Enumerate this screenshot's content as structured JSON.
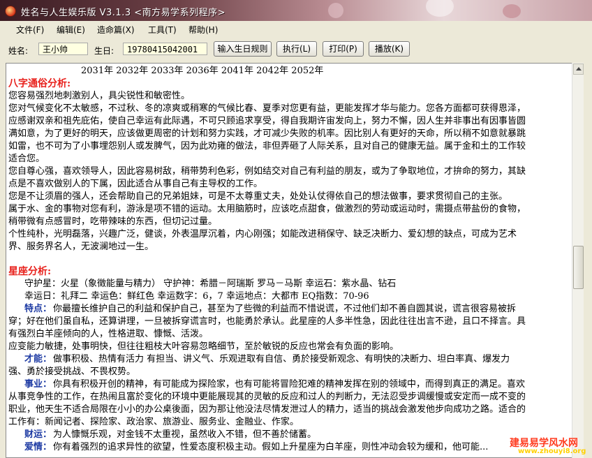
{
  "window": {
    "title": "姓名与人生娱乐版 V3.1.3   <南方易学系列程序>"
  },
  "menu": [
    "文件(F)",
    "编辑(E)",
    "造命篇(X)",
    "工具(T)",
    "帮助(H)"
  ],
  "form": {
    "name_label": "姓名:",
    "name_value": "王小帅",
    "birthday_label": "生日:",
    "birthday_value": "19780415042001"
  },
  "buttons": {
    "rule": "输入生日规则",
    "run": "执行(L)",
    "print": "打印(P)",
    "play": "播放(K)"
  },
  "content": {
    "years_line": "2031年 2032年 2033年 2036年 2041年 2042年 2052年",
    "folk_title": "八字通俗分析:",
    "folk_lines": [
      "您容易强烈地刺激别人，具尖锐性和敏密性。",
      "您对气候变化不太敏感，不过秋、冬的凉爽或稍寒的气候比春、夏季对您更有益，更能发挥才华与能力。您各方面都可获得恩泽，",
      "应感谢双亲和祖先庇佑，使自己幸运有此际遇，不可只顾追求享受，得自我期许宙发向上，努力不懈，因人生并非事出有因事皆圆",
      "满如意，为了更好的明天，应该做更周密的计划和努力实践，才可减少失败的机率。因比别人有更好的天命，所以稍不如意就暴跳",
      "如雷，也不可为了小事埋怨别人或发脾气，因为此劝雍的做法，非但弄砸了人际关系，且对自己的健康无益。属于金和土的工作较",
      "适合您。",
      "您自尊心强，喜欢领导人，因此容易树敌，稍带势利色彩，例如结交对自己有利益的朋友，或为了争取地位，才拚命的努力，其缺",
      "点是不喜欢做别人的下属，因此适合从事自己有主导权的工作。",
      "您是不让须眉的强人，还会帮助自己的兄弟姐妹，可是不太尊重丈夫，处处认仗得依自己的想法做事，要求贯彻自己的主张。",
      "属于水、金的事物对您有利，游泳是项不错的运动。太用脑筋时，应该吃点甜食，做激烈的劳动或运动时，需摄点带盐份的食物，",
      "稍带微有点感冒时，吃带辣味的东西，但切记过量。",
      "个性纯朴，光明磊落，兴趣广泛，健谈，外表温厚沉着，内心刚强；如能改进稍保守、缺乏决断力、爱幻想的缺点，可成为艺术",
      "界、服务界名人，无波澜地过一生。"
    ],
    "star_title": "星座分析:",
    "star_lines": [
      "守护星：火星（象徵能量与精力） 守护神：希腊－阿瑞斯 罗马－马斯 幸运石：紫水晶、钻石",
      "幸运日：礼拜二   幸运色：鲜红色  幸运数字：6，7   幸运地点：大都市  EQ指数：70-96"
    ],
    "trait_label": "特点：",
    "trait_lines": [
      "你最擅长维护自己的利益和保护自己，甚至为了些微的利益而不惜说谎，不过他们却不善自圆其说，谎言很容易被拆",
      "穿；好在他们虽自私，还算讲理，一旦被拆穿谎言时，也能勇於承认。此星座的人多半性急，因此往往出言不逊，且口不择言。具",
      "有强烈白羊座倾向的人，性格进取、慷慨、活泼。",
      "应变能力敏捷，处事明快，但往往粗枝大叶容易忽略细节，至於敏锐的反应也常会有负面的影响。"
    ],
    "talent_label": "才能：",
    "talent_lines": [
      "做事积极、热情有活力 有担当、讲义气、乐观进取有自信、勇於接受新观念、有明快的决断力、坦白率真、爆发力",
      "强、勇於接受挑战、不畏权势。"
    ],
    "career_label": "事业：",
    "career_lines": [
      "你具有积极开创的精神，有可能成为探险家，也有可能将冒险犯难的精神发挥在别的领域中，而得到真正的满足。喜欢",
      "从事竞争性的工作，在热闹且富於变化的环境中更能展现其的灵敏的反应和过人的判断力，无法忍受步调缓慢或安定而一成不变的",
      "职业，他天生不适合局限在小小的办公桌後面，因为那让他没法尽情发泄过人的精力，适当的挑战会激发他步向成功之路。适合的",
      "工作有：新闻记者、探险家、政治家、旅游业、服务业、金融业、作家。"
    ],
    "wealth_label": "财运：",
    "wealth_lines": [
      "为人慷慨乐观，对金钱不太重视，虽然收入不错，但不善於储蓄。"
    ],
    "love_label": "爱情：",
    "love_lines": [
      "你有着强烈的追求异性的欲望，性爱态度积极主动。假如上升星座为白羊座，则性冲动会较为缓和，他可能..."
    ]
  },
  "watermark": {
    "line1": "建易易学风水网",
    "line2": "www.zhouyi8.org"
  }
}
